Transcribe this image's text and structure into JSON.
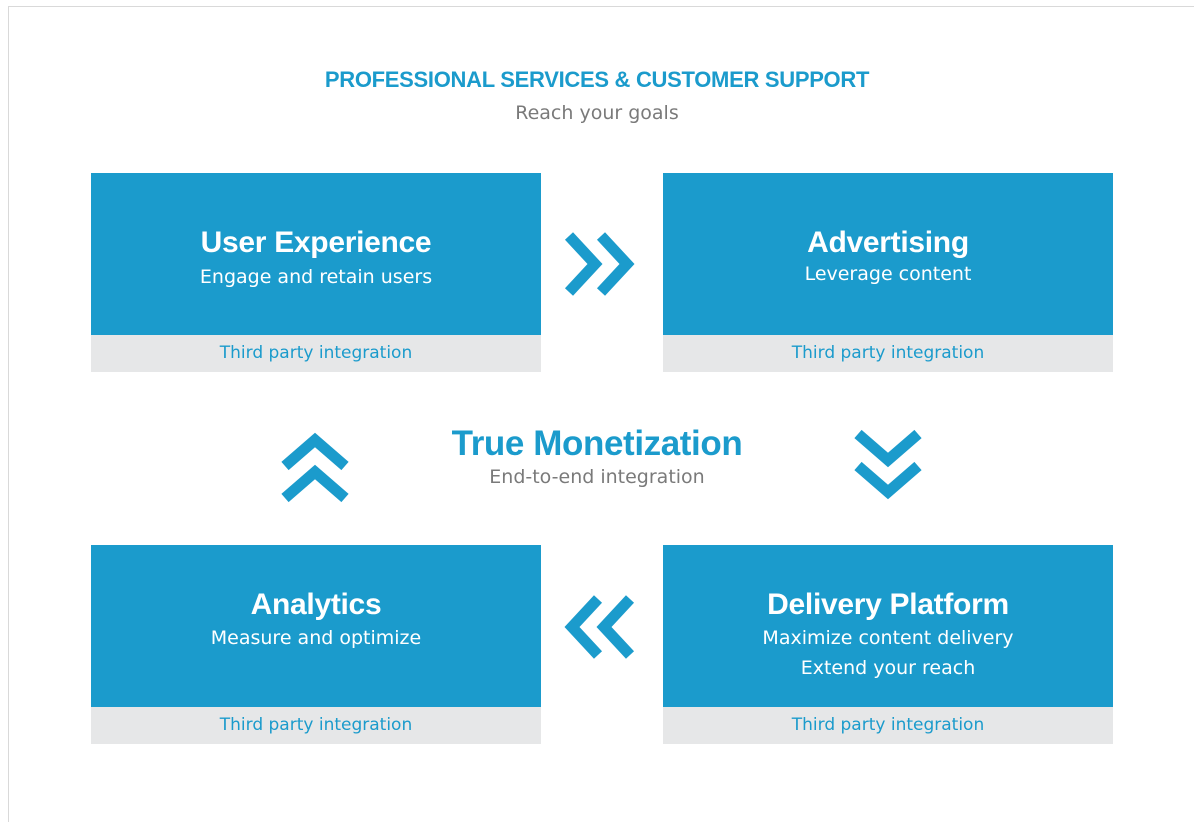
{
  "header": {
    "title": "PROFESSIONAL SERVICES & CUSTOMER SUPPORT",
    "subtitle": "Reach your goals"
  },
  "center": {
    "title": "True Monetization",
    "subtitle": "End-to-end integration"
  },
  "cards": {
    "user_experience": {
      "title": "User Experience",
      "line1": "Engage and retain users",
      "footer": "Third party integration"
    },
    "advertising": {
      "title": "Advertising",
      "line1": "Leverage content",
      "footer": "Third party integration"
    },
    "analytics": {
      "title": "Analytics",
      "line1": "Measure and optimize",
      "footer": "Third party integration"
    },
    "delivery_platform": {
      "title": "Delivery Platform",
      "line1": "Maximize content delivery",
      "line2": "Extend your reach",
      "footer": "Third party integration"
    }
  },
  "arrows": {
    "top": "double-chevron-right-icon",
    "right": "double-chevron-down-icon",
    "bottom": "double-chevron-left-icon",
    "left": "double-chevron-up-icon"
  },
  "colors": {
    "accent": "#1b9bcc",
    "footer_bg": "#e6e7e8",
    "muted_text": "#7a7a7a"
  }
}
